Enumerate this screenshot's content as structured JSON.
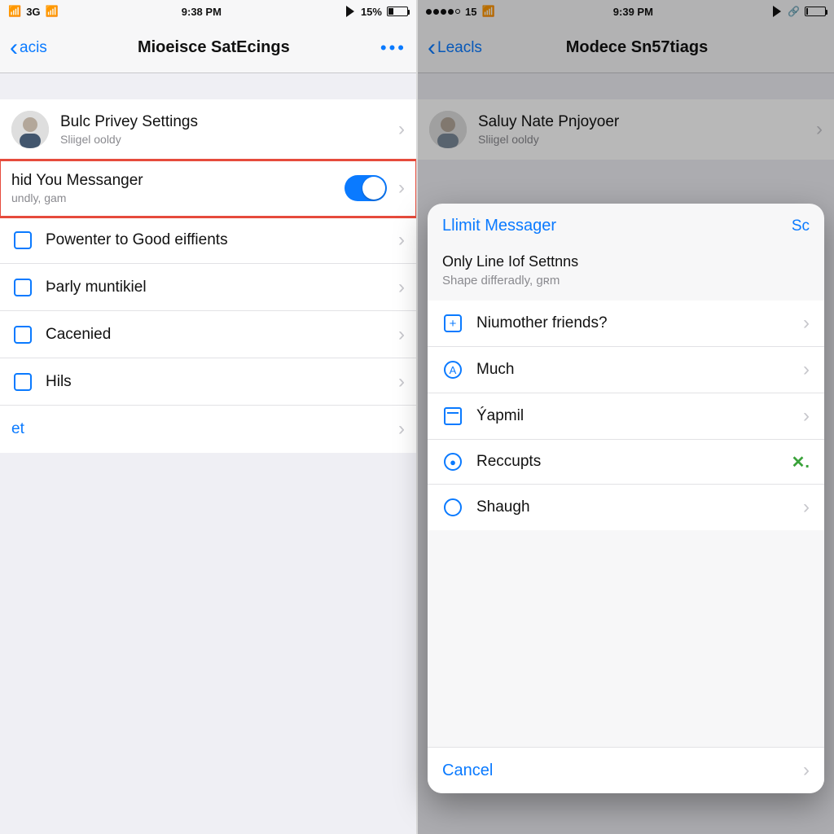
{
  "left": {
    "status": {
      "carrier": "3G",
      "time": "9:38 PM",
      "battery": "15%"
    },
    "nav": {
      "back": "acis",
      "title": "Mioeisce SatEcings",
      "more": "•••"
    },
    "profile": {
      "title": "Bulc Privey Settings",
      "sub": "Sliigel ooldy"
    },
    "rows": [
      {
        "title": "hid You Messanger",
        "sub": "undly, gam",
        "toggle": true,
        "highlight": true
      },
      {
        "title": "Powenter to Good eiffients",
        "sub": ""
      },
      {
        "title": "Þarly muntikiel",
        "sub": ""
      },
      {
        "title": "Cacenied",
        "sub": ""
      },
      {
        "title": "Hils",
        "sub": ""
      }
    ],
    "link": "et"
  },
  "right": {
    "status": {
      "carrier": "15",
      "time": "9:39 PM",
      "battery": "1%"
    },
    "nav": {
      "back": "Leacls",
      "title": "Modece Sn57tiags"
    },
    "profile": {
      "title": "Saluy Nate Pnjoyoer",
      "sub": "Sliigel ooldy"
    },
    "sheet": {
      "title": "Llimit Messager",
      "action": "Sc",
      "section_title": "Only Line Iof Settnns",
      "section_sub": "Shape differadly, gʀm",
      "items": [
        {
          "icon": "plus",
          "label": "Niumother friends?"
        },
        {
          "icon": "a",
          "label": "Much"
        },
        {
          "icon": "cal",
          "label": "Ýapmil"
        },
        {
          "icon": "mic",
          "label": "Reccupts",
          "check": true
        },
        {
          "icon": "face",
          "label": "Shaugh"
        }
      ],
      "cancel": "Cancel"
    }
  }
}
